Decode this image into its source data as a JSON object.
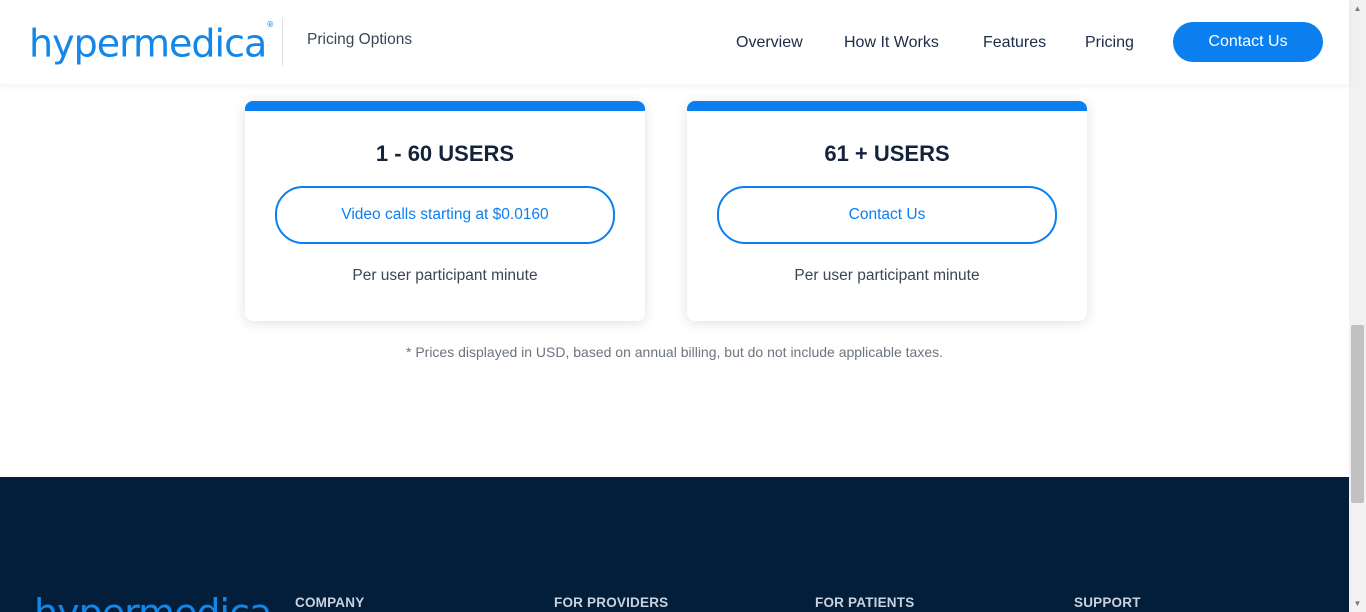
{
  "header": {
    "logo_text": "hypermedica",
    "logo_mark": "®",
    "subtitle": "Pricing Options",
    "nav": [
      "Overview",
      "How It Works",
      "Features",
      "Pricing"
    ],
    "contact_button": "Contact Us"
  },
  "pricing": {
    "cards": [
      {
        "title": "1 - 60 USERS",
        "cta": "Video calls starting at $0.0160",
        "note": "Per user participant minute"
      },
      {
        "title": "61 + USERS",
        "cta": "Contact Us",
        "note": "Per user participant minute"
      }
    ],
    "disclaimer": "* Prices displayed in USD, based on annual billing, but do not include applicable taxes."
  },
  "footer": {
    "logo_text": "hypermedica",
    "columns": [
      "COMPANY",
      "FOR PROVIDERS",
      "FOR PATIENTS",
      "SUPPORT"
    ]
  },
  "scrollbar": {
    "up_icon": "▲",
    "down_icon": "▼"
  },
  "colors": {
    "brand_blue": "#0b7ff0",
    "footer_navy": "#031e3b",
    "text_dark": "#14233c"
  }
}
